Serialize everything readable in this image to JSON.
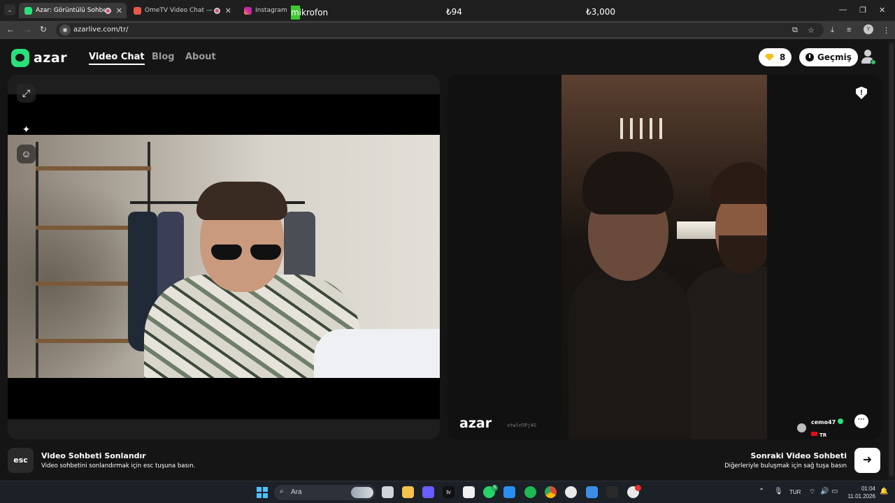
{
  "browser": {
    "tabs": [
      {
        "title": "Azar: Görüntülü Sohbet & Y",
        "active": true,
        "icon": "azar-favicon"
      },
      {
        "title": "OmeTV Video Chat — Ome",
        "active": false,
        "icon": "ometv-favicon"
      },
      {
        "title": "Instagram",
        "active": false,
        "icon": "instagram-favicon"
      }
    ],
    "overlay": {
      "mic_label": "mikrofon",
      "price_1": "₺94",
      "price_2": "₺3,000"
    },
    "url": "azarlive.com/tr/",
    "profile_initial": "Y"
  },
  "site": {
    "logo_text": "azar",
    "nav": [
      {
        "label": "Video Chat",
        "active": true
      },
      {
        "label": "Blog",
        "active": false
      },
      {
        "label": "About",
        "active": false
      }
    ],
    "gems": "8",
    "history_label": "Geçmiş"
  },
  "peer": {
    "watermark": "azar",
    "watermark_id": "xtwln5Pj4S",
    "username": "cemo47",
    "country": "TR"
  },
  "actions": {
    "esc_key": "esc",
    "end_title": "Video Sohbeti Sonlandır",
    "end_sub": "Video sohbetini sonlandırmak için esc tuşuna basın.",
    "next_title": "Sonraki Video Sohbeti",
    "next_sub": "Diğerleriyle buluşmak için sağ tuşa basın"
  },
  "taskbar": {
    "search_placeholder": "Ara",
    "whatsapp_badge": "5",
    "language": "TUR",
    "time": "01:04",
    "date": "11.01.2026"
  },
  "colors": {
    "brand_green": "#29e07a",
    "gem_yellow": "#f3c21a",
    "page_bg": "#151515"
  }
}
